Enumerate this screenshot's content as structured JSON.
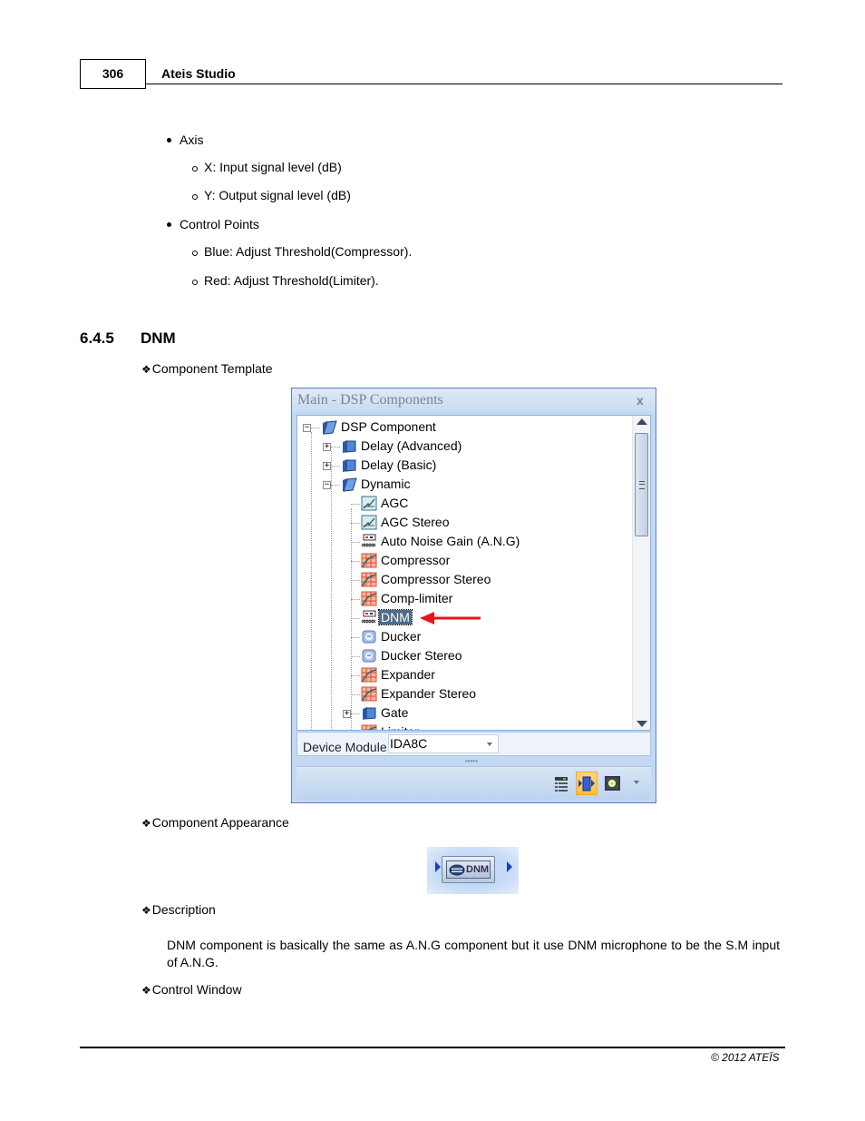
{
  "header": {
    "page_number": "306",
    "title": "Ateis Studio"
  },
  "intro_list": [
    {
      "label": "Axis",
      "children": [
        "X: Input signal level (dB)",
        "Y: Output signal level (dB)"
      ]
    },
    {
      "label": "Control Points",
      "children": [
        "Blue: Adjust Threshold(Compressor).",
        "Red: Adjust Threshold(Limiter)."
      ]
    }
  ],
  "section": {
    "number": "6.4.5",
    "title": "DNM"
  },
  "subheadings": {
    "template": "Component Template",
    "appearance": "Component Appearance",
    "description": "Description",
    "control_window": "Control Window"
  },
  "window": {
    "title": "Main - DSP Components",
    "close_glyph": "x",
    "tree": [
      {
        "label": "DSP Component",
        "icon": "folder-open-icon",
        "level": 0,
        "expander": "minus"
      },
      {
        "label": "Delay (Advanced)",
        "icon": "folder-icon",
        "level": 1,
        "expander": "plus"
      },
      {
        "label": "Delay (Basic)",
        "icon": "folder-icon",
        "level": 1,
        "expander": "plus"
      },
      {
        "label": "Dynamic",
        "icon": "folder-open-icon",
        "level": 1,
        "expander": "minus"
      },
      {
        "label": "AGC",
        "icon": "agc-icon",
        "level": 2
      },
      {
        "label": "AGC Stereo",
        "icon": "agc-icon",
        "level": 2
      },
      {
        "label": "Auto Noise Gain (A.N.G)",
        "icon": "ang-icon",
        "level": 2
      },
      {
        "label": "Compressor",
        "icon": "curve-grid-icon",
        "level": 2
      },
      {
        "label": "Compressor Stereo",
        "icon": "curve-grid-icon",
        "level": 2
      },
      {
        "label": "Comp-limiter",
        "icon": "curve-grid-icon",
        "level": 2
      },
      {
        "label": "DNM",
        "icon": "ang-icon",
        "level": 2,
        "selected": true
      },
      {
        "label": "Ducker",
        "icon": "ducker-icon",
        "level": 2
      },
      {
        "label": "Ducker Stereo",
        "icon": "ducker-icon",
        "level": 2
      },
      {
        "label": "Expander",
        "icon": "curve-grid-icon",
        "level": 2
      },
      {
        "label": "Expander Stereo",
        "icon": "curve-grid-icon",
        "level": 2
      },
      {
        "label": "Gate",
        "icon": "folder-icon",
        "level": 2,
        "expander": "plus"
      },
      {
        "label": "Limiter",
        "icon": "curve-grid-icon",
        "level": 2
      }
    ],
    "device_module_label": "Device Module",
    "device_module_value": "IDA8C",
    "splitter_dots": "•••••",
    "toolbar": [
      {
        "name": "list-view-icon",
        "active": false
      },
      {
        "name": "component-view-icon",
        "active": true
      },
      {
        "name": "image-view-icon",
        "active": false
      }
    ]
  },
  "component_appearance": {
    "label": "DNM"
  },
  "description_text": "DNM component is basically the same as A.N.G component but it use DNM microphone to be the S.M input of A.N.G.",
  "footer": {
    "copyright": "© 2012 ATEÏS"
  },
  "colors": {
    "selection": "#4e6b8a",
    "annotation_arrow": "#e8141b",
    "window_border": "#5a7fb8",
    "port_arrow": "#1a3fbf"
  }
}
